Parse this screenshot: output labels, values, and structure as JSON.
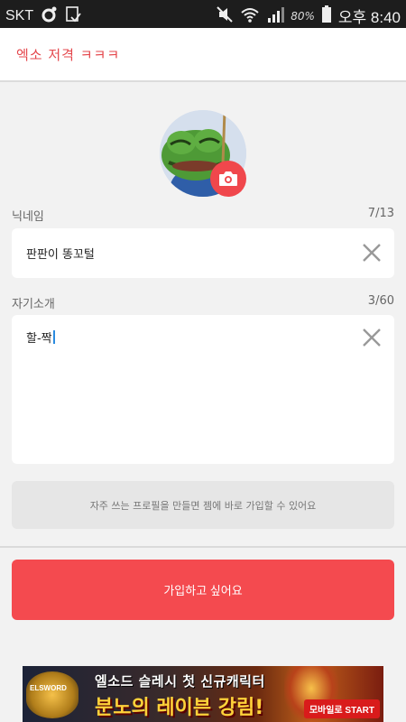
{
  "status_bar": {
    "carrier": "SKT",
    "battery_percent": "80%",
    "time": "오후 8:40"
  },
  "header": {
    "title": "엑소 저격 ㅋㅋㅋ"
  },
  "profile": {
    "nickname_label": "닉네임",
    "nickname_counter": "7/13",
    "nickname_value": "판판이 똥꼬털",
    "bio_label": "자기소개",
    "bio_counter": "3/60",
    "bio_value": "할-짝"
  },
  "hint": {
    "text": "자주 쓰는 프로필을 만들면 젬에 바로 가입할 수 있어요"
  },
  "join_button": {
    "label": "가입하고 싶어요"
  },
  "banner": {
    "logo_text": "ELSWORD",
    "line1": "엘소드 슬레시 첫 신규캐릭터",
    "line2": "분노의 레이븐 강림!",
    "cta": "모바일로 START"
  },
  "colors": {
    "accent": "#f44a4f",
    "title": "#e4474c",
    "background": "#f2f2f2"
  }
}
